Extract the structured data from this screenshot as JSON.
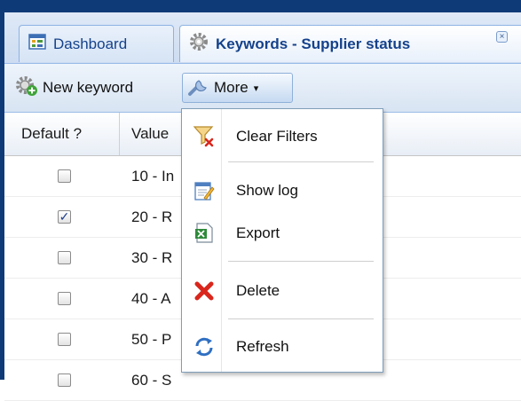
{
  "tabs": [
    {
      "label": "Dashboard",
      "icon": "dashboard-icon"
    },
    {
      "label": "Keywords - Supplier status",
      "icon": "gear-icon",
      "close_symbol": "×"
    }
  ],
  "toolbar": {
    "new_label": "New keyword",
    "new_icon": "gear-add-icon",
    "more_label": "More",
    "more_icon": "wrench-icon",
    "more_caret": "▾"
  },
  "grid": {
    "columns": [
      "Default ?",
      "Value"
    ],
    "rows": [
      {
        "default": false,
        "value": "10 - In"
      },
      {
        "default": true,
        "value": "20 - R"
      },
      {
        "default": false,
        "value": "30 - R"
      },
      {
        "default": false,
        "value": "40 - A"
      },
      {
        "default": false,
        "value": "50 - P"
      },
      {
        "default": false,
        "value": "60 - S"
      }
    ],
    "check_symbol": "✓"
  },
  "menu": {
    "items": [
      {
        "label": "Clear Filters",
        "icon": "filter-clear-icon"
      },
      {
        "label": "Show log",
        "icon": "log-icon"
      },
      {
        "label": "Export",
        "icon": "excel-icon"
      },
      {
        "label": "Delete",
        "icon": "delete-icon"
      },
      {
        "label": "Refresh",
        "icon": "refresh-icon"
      }
    ]
  },
  "colors": {
    "header_blue": "#0f3a78",
    "tab_text": "#15428b",
    "delete_red": "#d9261c"
  }
}
